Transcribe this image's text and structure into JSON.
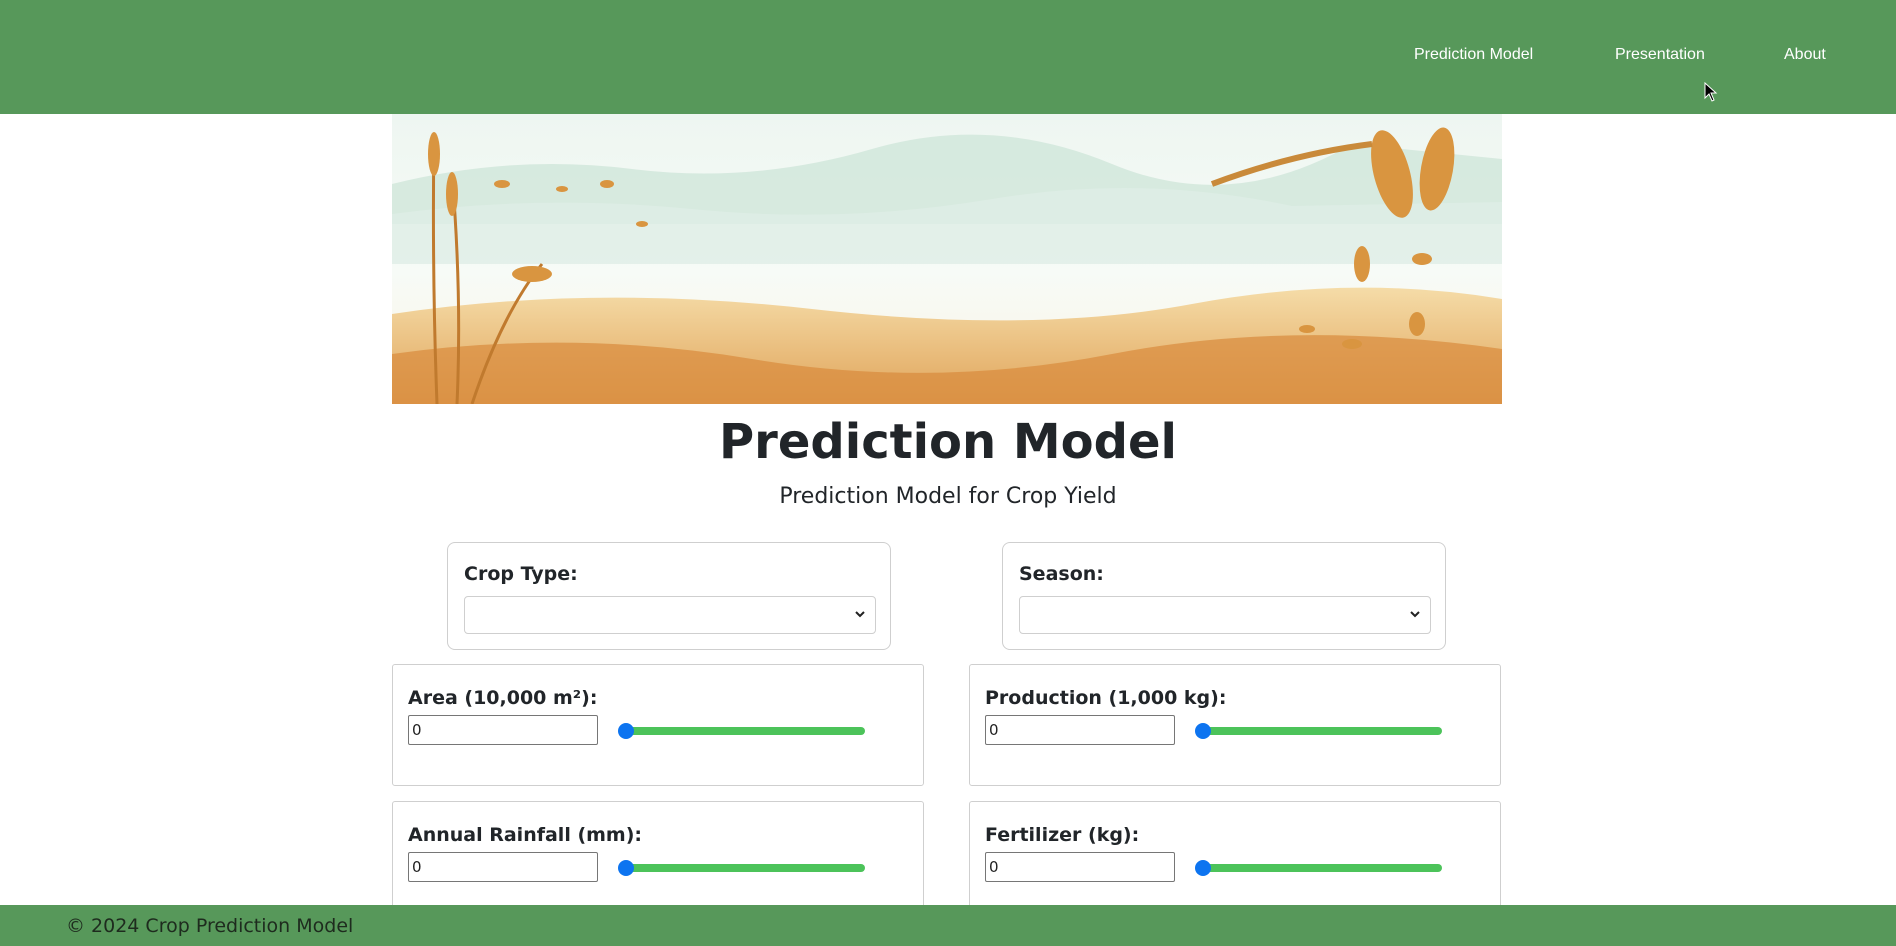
{
  "nav": {
    "items": [
      "Prediction Model",
      "Presentation",
      "About"
    ]
  },
  "header": {
    "title": "Prediction Model",
    "subtitle": "Prediction Model for Crop Yield"
  },
  "selects": {
    "crop_type": {
      "label": "Crop Type:",
      "value": ""
    },
    "season": {
      "label": "Season:",
      "value": ""
    }
  },
  "fields": {
    "area": {
      "label": "Area (10,000 m²):",
      "value": "0",
      "slider": 0
    },
    "production": {
      "label": "Production (1,000 kg):",
      "value": "0",
      "slider": 0
    },
    "rainfall": {
      "label": "Annual Rainfall (mm):",
      "value": "0",
      "slider": 0
    },
    "fertilizer": {
      "label": "Fertilizer (kg):",
      "value": "0",
      "slider": 0
    }
  },
  "footer": {
    "text": "© 2024 Crop Prediction Model"
  },
  "colors": {
    "nav_bg": "#57985a",
    "slider_track": "#4cc35a",
    "slider_thumb": "#0d74f0"
  }
}
